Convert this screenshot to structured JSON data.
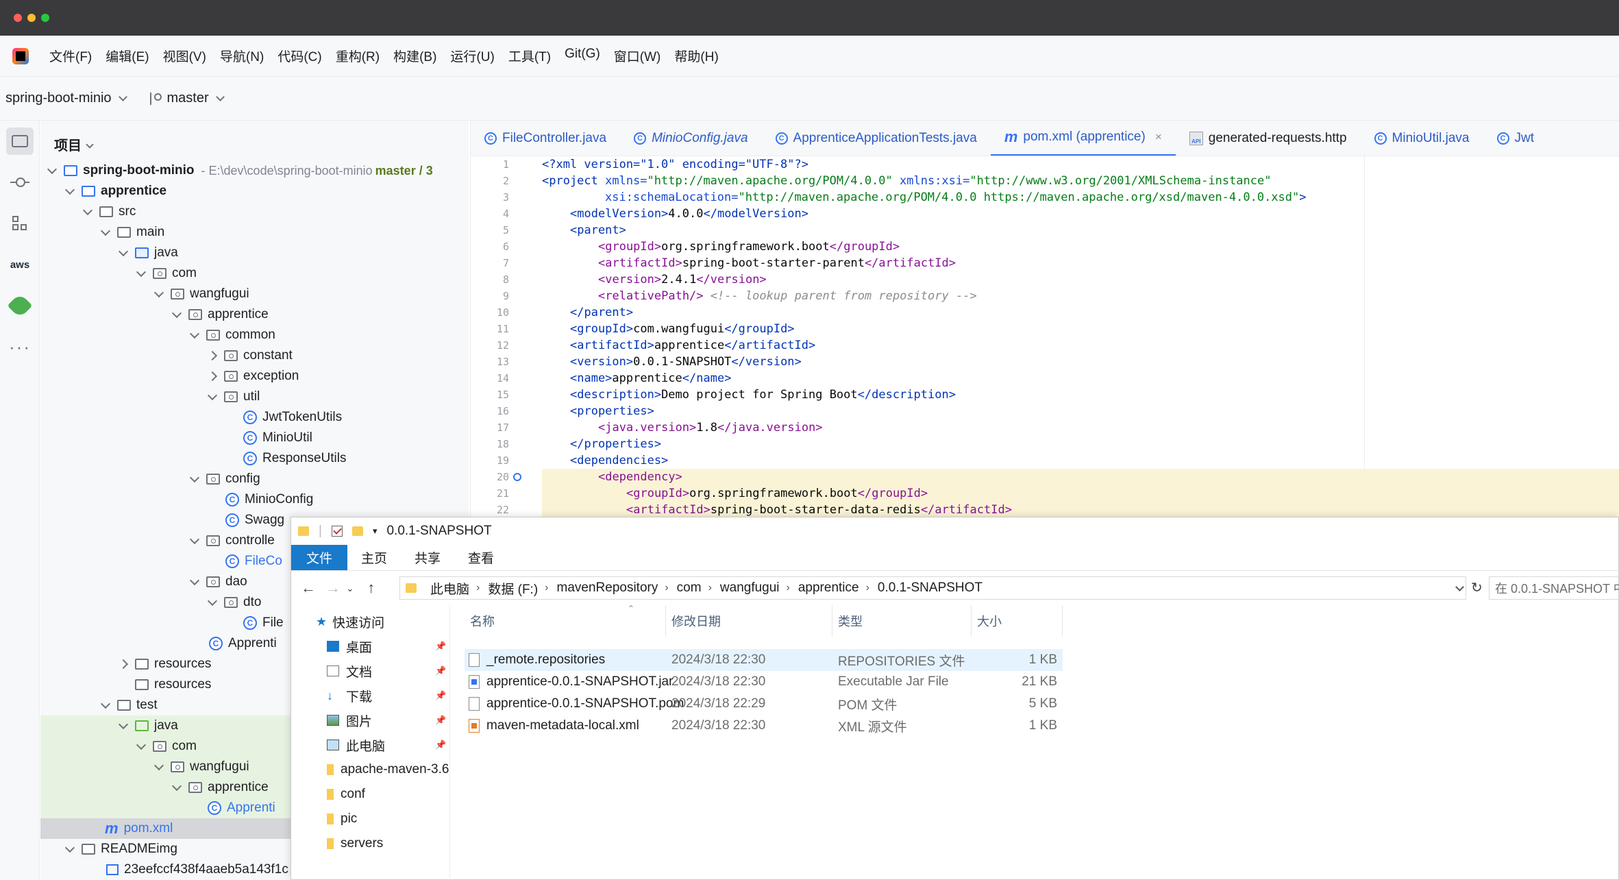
{
  "menu": [
    "文件(F)",
    "编辑(E)",
    "视图(V)",
    "导航(N)",
    "代码(C)",
    "重构(R)",
    "构建(B)",
    "运行(U)",
    "工具(T)",
    "Git(G)",
    "窗口(W)",
    "帮助(H)"
  ],
  "project_bar": {
    "project_name": "spring-boot-minio",
    "branch": "master"
  },
  "project_panel": {
    "title": "项目",
    "root": {
      "label": "spring-boot-minio",
      "path": "- E:\\dev\\code\\spring-boot-minio",
      "branch": "master / 3"
    },
    "tree": [
      "apprentice",
      "src",
      "main",
      "java",
      "com",
      "wangfugui",
      "apprentice",
      "common",
      "constant",
      "exception",
      "util",
      "JwtTokenUtils",
      "MinioUtil",
      "ResponseUtils",
      "config",
      "MinioConfig",
      "Swagg",
      "controlle",
      "FileCo",
      "dao",
      "dto",
      "File",
      "Apprenti",
      "resources",
      "resources",
      "test",
      "java",
      "com",
      "wangfugui",
      "apprentice",
      "Apprenti",
      "pom.xml",
      "READMEimg",
      "23eefccf438f4aaeb5a143f1c"
    ]
  },
  "editor": {
    "tabs": [
      {
        "label": "FileController.java"
      },
      {
        "label": "MinioConfig.java"
      },
      {
        "label": "ApprenticeApplicationTests.java"
      },
      {
        "label": "pom.xml (apprentice)",
        "close": "×"
      },
      {
        "label": "generated-requests.http",
        "icon_text": "API"
      },
      {
        "label": "MinioUtil.java"
      },
      {
        "label": "Jwt"
      }
    ],
    "line_numbers": [
      "1",
      "2",
      "3",
      "4",
      "5",
      "6",
      "7",
      "8",
      "9",
      "10",
      "11",
      "12",
      "13",
      "14",
      "15",
      "16",
      "17",
      "18",
      "19",
      "20",
      "21",
      "22"
    ],
    "code": {
      "l1": "<?xml version=\"1.0\" encoding=\"UTF-8\"?>",
      "l2_tag": "<project",
      "l2_a1": " xmlns=",
      "l2_v1": "\"http://maven.apache.org/POM/4.0.0\"",
      "l2_a2": " xmlns:xsi=",
      "l2_v2": "\"http://www.w3.org/2001/XMLSchema-instance\"",
      "l3_a": "xsi:schemaLocation=",
      "l3_v": "\"http://maven.apache.org/POM/4.0.0 https://maven.apache.org/xsd/maven-4.0.0.xsd\"",
      "l3_end": ">",
      "l4_o": "<modelVersion>",
      "l4_t": "4.0.0",
      "l4_c": "</modelVersion>",
      "l5": "<parent>",
      "l6_o": "<groupId>",
      "l6_t": "org.springframework.boot",
      "l6_c": "</groupId>",
      "l7_o": "<artifactId>",
      "l7_t": "spring-boot-starter-parent",
      "l7_c": "</artifactId>",
      "l8_o": "<version>",
      "l8_t": "2.4.1",
      "l8_c": "</version>",
      "l9_o": "<relativePath/>",
      "l9_cm": " <!-- lookup parent from repository -->",
      "l10": "</parent>",
      "l11_o": "<groupId>",
      "l11_t": "com.wangfugui",
      "l11_c": "</groupId>",
      "l12_o": "<artifactId>",
      "l12_t": "apprentice",
      "l12_c": "</artifactId>",
      "l13_o": "<version>",
      "l13_t": "0.0.1-SNAPSHOT",
      "l13_c": "</version>",
      "l14_o": "<name>",
      "l14_t": "apprentice",
      "l14_c": "</name>",
      "l15_o": "<description>",
      "l15_t": "Demo project for Spring Boot",
      "l15_c": "</description>",
      "l16": "<properties>",
      "l17_o": "<java.version>",
      "l17_t": "1.8",
      "l17_c": "</java.version>",
      "l18": "</properties>",
      "l19": "<dependencies>",
      "l20": "<dependency>",
      "l21_o": "<groupId>",
      "l21_t": "org.springframework.boot",
      "l21_c": "</groupId>",
      "l22_o": "<artifactId>",
      "l22_t": "spring-boot-starter-data-redis",
      "l22_c": "</artifactId>"
    }
  },
  "explorer": {
    "title": "0.0.1-SNAPSHOT",
    "ribbon_tabs": [
      "文件",
      "主页",
      "共享",
      "查看"
    ],
    "breadcrumbs": [
      "此电脑",
      "数据 (F:)",
      "mavenRepository",
      "com",
      "wangfugui",
      "apprentice",
      "0.0.1-SNAPSHOT"
    ],
    "search_placeholder": "在 0.0.1-SNAPSHOT 中",
    "nav": [
      {
        "label": "快速访问",
        "pinned": false
      },
      {
        "label": "桌面",
        "pinned": true
      },
      {
        "label": "文档",
        "pinned": true
      },
      {
        "label": "下载",
        "pinned": true
      },
      {
        "label": "图片",
        "pinned": true
      },
      {
        "label": "此电脑",
        "pinned": true
      },
      {
        "label": "apache-maven-3.6",
        "pinned": false
      },
      {
        "label": "conf",
        "pinned": false
      },
      {
        "label": "pic",
        "pinned": false
      },
      {
        "label": "servers",
        "pinned": false
      }
    ],
    "columns": [
      "名称",
      "修改日期",
      "类型",
      "大小"
    ],
    "files": [
      {
        "name": "_remote.repositories",
        "date": "2024/3/18 22:30",
        "type": "REPOSITORIES 文件",
        "size": "1 KB"
      },
      {
        "name": "apprentice-0.0.1-SNAPSHOT.jar",
        "date": "2024/3/18 22:30",
        "type": "Executable Jar File",
        "size": "21 KB"
      },
      {
        "name": "apprentice-0.0.1-SNAPSHOT.pom",
        "date": "2024/3/18 22:29",
        "type": "POM 文件",
        "size": "5 KB"
      },
      {
        "name": "maven-metadata-local.xml",
        "date": "2024/3/18 22:30",
        "type": "XML 源文件",
        "size": "1 KB"
      }
    ]
  }
}
